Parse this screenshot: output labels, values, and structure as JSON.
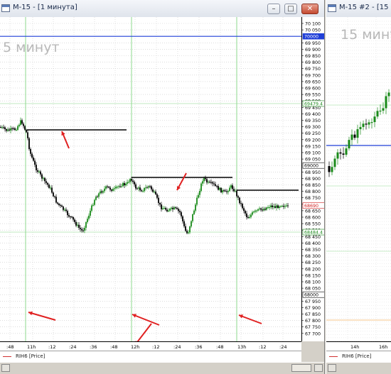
{
  "window1": {
    "title": "M-15 - [1 минута]",
    "watermark": "5 минут",
    "legend": "RIH6 [Price]",
    "price_labels": [
      "70 100",
      "70 050",
      "69 950",
      "69 900",
      "69 850",
      "69 800",
      "69 750",
      "69 700",
      "69 650",
      "69 600",
      "69 550",
      "69 500",
      "69 450",
      "69 400",
      "69 350",
      "69 300",
      "69 250",
      "69 200",
      "69 150",
      "69 100",
      "69 050",
      "68 950",
      "68 900",
      "68 850",
      "68 800",
      "68 750",
      "68 700",
      "68 650",
      "68 600",
      "68 550",
      "68 500",
      "68 450",
      "68 400",
      "68 350",
      "68 300",
      "68 250",
      "68 200",
      "68 150",
      "68 100",
      "68 050",
      "67 950",
      "67 900",
      "67 850",
      "67 800",
      "67 750",
      "67 700"
    ],
    "price_markers": [
      {
        "text": "70000",
        "bg": "#1f3fd8",
        "fg": "#ffffff"
      },
      {
        "text": "69479.4",
        "bg": "#ffffff",
        "fg": "#1a8a1a"
      },
      {
        "text": "69000",
        "bg": "#ffffff",
        "fg": "#000000"
      },
      {
        "text": "68690",
        "bg": "#ffffff",
        "fg": "#d02020"
      },
      {
        "text": "68484.4",
        "bg": "#ffffff",
        "fg": "#1a8a1a"
      },
      {
        "text": "68000",
        "bg": "#ffffff",
        "fg": "#000000"
      }
    ],
    "time_labels": [
      ":48",
      "11h",
      ":12",
      ":24",
      ":36",
      ":48",
      "12h",
      ":12",
      ":24",
      ":36",
      ":48",
      "13h",
      ":12",
      ":24"
    ]
  },
  "window2": {
    "title": "M-15 #2 - [15 минут]",
    "watermark": "15 мину",
    "legend": "RIH6 [Price]",
    "time_labels": [
      "14h",
      "16h"
    ]
  },
  "colors": {
    "up": "#1a8a1a",
    "down": "#000000",
    "session": "#8ed88e",
    "blue_line": "#1f3fd8",
    "arrow": "#e02020"
  },
  "chart_data": {
    "type": "candlestick",
    "symbol": "RIH6",
    "reference_levels": [
      70000,
      69479.4,
      68484.4
    ],
    "last_price": 68690,
    "resistance_levels": [
      69300,
      68920,
      68820
    ],
    "approx_path": [
      {
        "t": ":48",
        "price": 69300
      },
      {
        "t": "11h",
        "price": 69250
      },
      {
        "t": ":12",
        "price": 68750
      },
      {
        "t": ":24",
        "price": 68550
      },
      {
        "t": ":36",
        "price": 68750
      },
      {
        "t": ":48",
        "price": 68800
      },
      {
        "t": "12h",
        "price": 68930
      },
      {
        "t": ":12",
        "price": 68780
      },
      {
        "t": ":24",
        "price": 68500
      },
      {
        "t": ":36",
        "price": 68900
      },
      {
        "t": ":48",
        "price": 68800
      },
      {
        "t": "13h",
        "price": 68600
      },
      {
        "t": ":12",
        "price": 68650
      },
      {
        "t": ":24",
        "price": 68690
      }
    ]
  }
}
